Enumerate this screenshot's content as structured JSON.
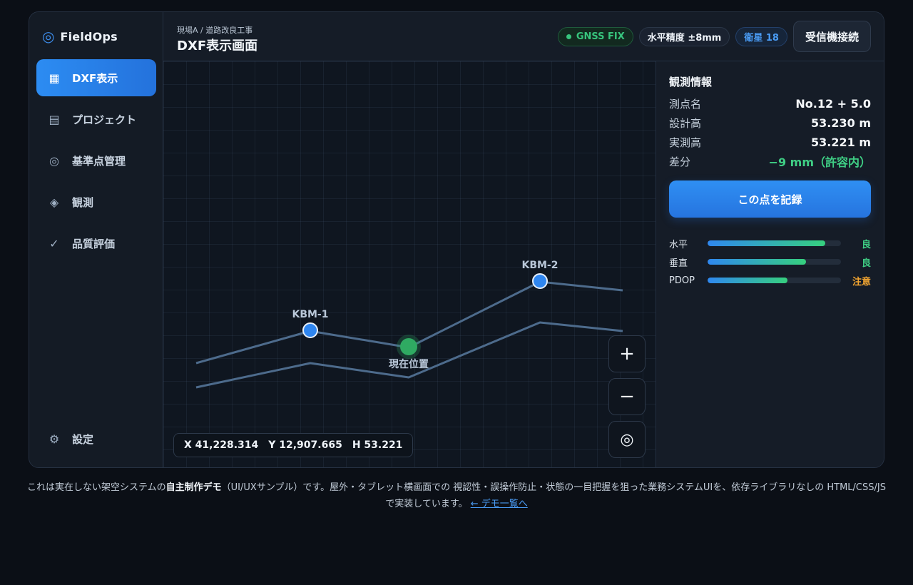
{
  "brand": {
    "name": "FieldOps",
    "icon": "target-icon"
  },
  "sidebar": {
    "items": [
      {
        "label": "DXF表示",
        "icon": "grid-icon",
        "glyph": "▦",
        "active": true
      },
      {
        "label": "プロジェクト",
        "icon": "list-icon",
        "glyph": "▤",
        "active": false
      },
      {
        "label": "基準点管理",
        "icon": "target-icon",
        "glyph": "◎",
        "active": false
      },
      {
        "label": "観測",
        "icon": "diamond-icon",
        "glyph": "◈",
        "active": false
      },
      {
        "label": "品質評価",
        "icon": "check-icon",
        "glyph": "✓",
        "active": false
      }
    ],
    "settings": {
      "label": "設定",
      "icon": "gear-icon",
      "glyph": "⚙"
    }
  },
  "header": {
    "breadcrumb": "現場A / 道路改良工事",
    "title": "DXF表示画面",
    "gnss": "GNSS FIX",
    "accuracy": "水平精度 ±8mm",
    "satellites": "衛星 18",
    "connect_button": "受信機接続"
  },
  "map": {
    "points": [
      {
        "label": "KBM-1"
      },
      {
        "label": "KBM-2"
      }
    ],
    "current_position_label": "現在位置",
    "zoom_in": "+",
    "zoom_out": "−",
    "locate_glyph": "◎",
    "coords": {
      "x": "X 41,228.314",
      "y": "Y 12,907.665",
      "h": "H 53.221"
    }
  },
  "panel": {
    "title": "観測情報",
    "rows": [
      {
        "key": "測点名",
        "value": "No.12 + 5.0"
      },
      {
        "key": "設計高",
        "value": "53.230 m"
      },
      {
        "key": "実測高",
        "value": "53.221 m"
      },
      {
        "key": "差分",
        "value": "−9 mm（許容内）",
        "status": "good"
      }
    ],
    "record_button": "この点を記録",
    "meters": [
      {
        "label": "水平",
        "level": 0.88,
        "status": "良",
        "status_color": "#3fcf85"
      },
      {
        "label": "垂直",
        "level": 0.74,
        "status": "良",
        "status_color": "#3fcf85"
      },
      {
        "label": "PDOP",
        "level": 0.6,
        "status": "注意",
        "status_color": "#f2a531"
      }
    ]
  },
  "colors": {
    "accent": "#2c8cf2",
    "good": "#3fcf85",
    "warning": "#f2a531",
    "current_position": "#2faa62"
  },
  "footer": {
    "text_before": "これは実在しない架空システムの",
    "emphasis": "自主制作デモ",
    "text_after": "（UI/UXサンプル）です。屋外・タブレット横画面での 視認性・誤操作防止・状態の一目把握を狙った業務システムUIを、依存ライブラリなしの HTML/CSS/JS で実装しています。",
    "link": "← デモ一覧へ"
  }
}
